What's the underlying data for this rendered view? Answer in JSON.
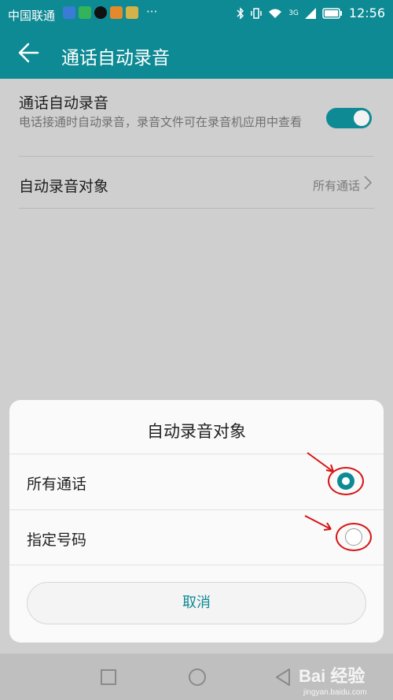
{
  "status_bar": {
    "carrier": "中国联通",
    "more_indicator": "···",
    "time": "12:56",
    "network_label": "3G",
    "icons": [
      "app-icon-blue",
      "app-icon-green",
      "tiktok-icon",
      "app-icon-orange",
      "app-icon-yellow",
      "bluetooth-icon",
      "vibrate-icon",
      "wifi-icon",
      "signal-icon",
      "battery-icon"
    ]
  },
  "app_bar": {
    "title": "通话自动录音",
    "back_icon": "back-arrow-icon"
  },
  "settings": {
    "auto_record": {
      "label": "通话自动录音",
      "description": "电话接通时自动录音，录音文件可在录音机应用中查看",
      "enabled": true
    },
    "record_target": {
      "label": "自动录音对象",
      "value": "所有通话",
      "chevron_icon": "chevron-right-icon"
    }
  },
  "dialog": {
    "title": "自动录音对象",
    "options": [
      {
        "label": "所有通话",
        "selected": true
      },
      {
        "label": "指定号码",
        "selected": false
      }
    ],
    "cancel_label": "取消"
  },
  "annotations": {
    "arrow_color": "#d81414",
    "ring_color": "#d81414"
  },
  "nav_bar": {
    "icons": [
      "recent-apps-icon",
      "home-icon",
      "back-icon"
    ]
  },
  "watermark": {
    "text": "Bai 经验",
    "subtext": "jingyan.baidu.com"
  },
  "colors": {
    "accent": "#0e8a94",
    "scrim": "#cfcfcf",
    "dialog_bg": "#fafafa"
  }
}
